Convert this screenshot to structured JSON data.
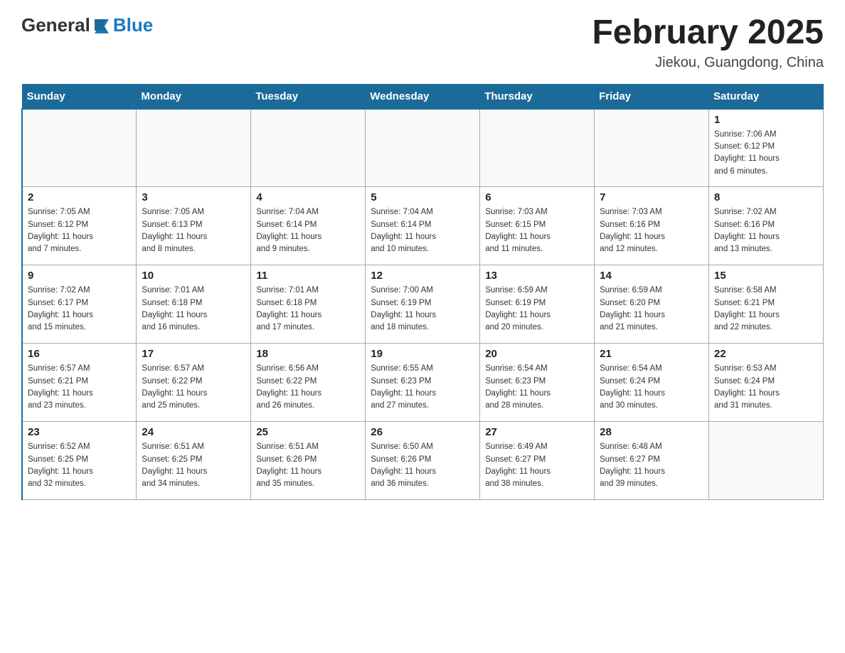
{
  "header": {
    "logo_general": "General",
    "logo_blue": "Blue",
    "title": "February 2025",
    "subtitle": "Jiekou, Guangdong, China"
  },
  "weekdays": [
    "Sunday",
    "Monday",
    "Tuesday",
    "Wednesday",
    "Thursday",
    "Friday",
    "Saturday"
  ],
  "weeks": [
    [
      {
        "day": "",
        "info": ""
      },
      {
        "day": "",
        "info": ""
      },
      {
        "day": "",
        "info": ""
      },
      {
        "day": "",
        "info": ""
      },
      {
        "day": "",
        "info": ""
      },
      {
        "day": "",
        "info": ""
      },
      {
        "day": "1",
        "info": "Sunrise: 7:06 AM\nSunset: 6:12 PM\nDaylight: 11 hours\nand 6 minutes."
      }
    ],
    [
      {
        "day": "2",
        "info": "Sunrise: 7:05 AM\nSunset: 6:12 PM\nDaylight: 11 hours\nand 7 minutes."
      },
      {
        "day": "3",
        "info": "Sunrise: 7:05 AM\nSunset: 6:13 PM\nDaylight: 11 hours\nand 8 minutes."
      },
      {
        "day": "4",
        "info": "Sunrise: 7:04 AM\nSunset: 6:14 PM\nDaylight: 11 hours\nand 9 minutes."
      },
      {
        "day": "5",
        "info": "Sunrise: 7:04 AM\nSunset: 6:14 PM\nDaylight: 11 hours\nand 10 minutes."
      },
      {
        "day": "6",
        "info": "Sunrise: 7:03 AM\nSunset: 6:15 PM\nDaylight: 11 hours\nand 11 minutes."
      },
      {
        "day": "7",
        "info": "Sunrise: 7:03 AM\nSunset: 6:16 PM\nDaylight: 11 hours\nand 12 minutes."
      },
      {
        "day": "8",
        "info": "Sunrise: 7:02 AM\nSunset: 6:16 PM\nDaylight: 11 hours\nand 13 minutes."
      }
    ],
    [
      {
        "day": "9",
        "info": "Sunrise: 7:02 AM\nSunset: 6:17 PM\nDaylight: 11 hours\nand 15 minutes."
      },
      {
        "day": "10",
        "info": "Sunrise: 7:01 AM\nSunset: 6:18 PM\nDaylight: 11 hours\nand 16 minutes."
      },
      {
        "day": "11",
        "info": "Sunrise: 7:01 AM\nSunset: 6:18 PM\nDaylight: 11 hours\nand 17 minutes."
      },
      {
        "day": "12",
        "info": "Sunrise: 7:00 AM\nSunset: 6:19 PM\nDaylight: 11 hours\nand 18 minutes."
      },
      {
        "day": "13",
        "info": "Sunrise: 6:59 AM\nSunset: 6:19 PM\nDaylight: 11 hours\nand 20 minutes."
      },
      {
        "day": "14",
        "info": "Sunrise: 6:59 AM\nSunset: 6:20 PM\nDaylight: 11 hours\nand 21 minutes."
      },
      {
        "day": "15",
        "info": "Sunrise: 6:58 AM\nSunset: 6:21 PM\nDaylight: 11 hours\nand 22 minutes."
      }
    ],
    [
      {
        "day": "16",
        "info": "Sunrise: 6:57 AM\nSunset: 6:21 PM\nDaylight: 11 hours\nand 23 minutes."
      },
      {
        "day": "17",
        "info": "Sunrise: 6:57 AM\nSunset: 6:22 PM\nDaylight: 11 hours\nand 25 minutes."
      },
      {
        "day": "18",
        "info": "Sunrise: 6:56 AM\nSunset: 6:22 PM\nDaylight: 11 hours\nand 26 minutes."
      },
      {
        "day": "19",
        "info": "Sunrise: 6:55 AM\nSunset: 6:23 PM\nDaylight: 11 hours\nand 27 minutes."
      },
      {
        "day": "20",
        "info": "Sunrise: 6:54 AM\nSunset: 6:23 PM\nDaylight: 11 hours\nand 28 minutes."
      },
      {
        "day": "21",
        "info": "Sunrise: 6:54 AM\nSunset: 6:24 PM\nDaylight: 11 hours\nand 30 minutes."
      },
      {
        "day": "22",
        "info": "Sunrise: 6:53 AM\nSunset: 6:24 PM\nDaylight: 11 hours\nand 31 minutes."
      }
    ],
    [
      {
        "day": "23",
        "info": "Sunrise: 6:52 AM\nSunset: 6:25 PM\nDaylight: 11 hours\nand 32 minutes."
      },
      {
        "day": "24",
        "info": "Sunrise: 6:51 AM\nSunset: 6:25 PM\nDaylight: 11 hours\nand 34 minutes."
      },
      {
        "day": "25",
        "info": "Sunrise: 6:51 AM\nSunset: 6:26 PM\nDaylight: 11 hours\nand 35 minutes."
      },
      {
        "day": "26",
        "info": "Sunrise: 6:50 AM\nSunset: 6:26 PM\nDaylight: 11 hours\nand 36 minutes."
      },
      {
        "day": "27",
        "info": "Sunrise: 6:49 AM\nSunset: 6:27 PM\nDaylight: 11 hours\nand 38 minutes."
      },
      {
        "day": "28",
        "info": "Sunrise: 6:48 AM\nSunset: 6:27 PM\nDaylight: 11 hours\nand 39 minutes."
      },
      {
        "day": "",
        "info": ""
      }
    ]
  ]
}
